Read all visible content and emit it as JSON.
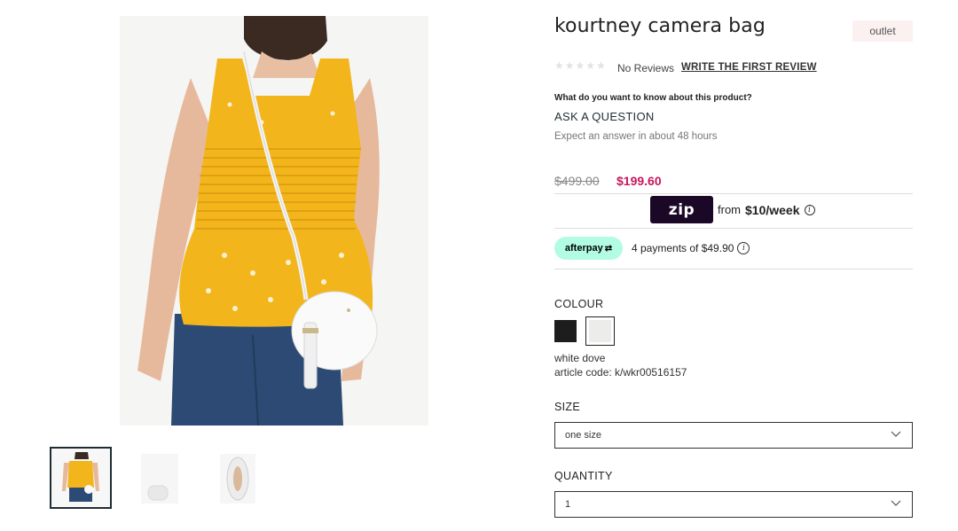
{
  "product": {
    "title": "kourtney camera bag",
    "badge": "outlet"
  },
  "reviews": {
    "rating": 0,
    "max_stars": 5,
    "count_label": "No Reviews",
    "write_link": "WRITE THE FIRST REVIEW"
  },
  "questions": {
    "prompt": "What do you want to know about this product?",
    "ask_link": "ASK A QUESTION",
    "note": "Expect an answer in about 48 hours"
  },
  "pricing": {
    "original": "$499.00",
    "sale": "$199.60",
    "sale_color": "#c5185d"
  },
  "zip": {
    "logo_text": "zip",
    "from_label": "from",
    "amount": "$10/week",
    "info_icon": "info-icon"
  },
  "afterpay": {
    "logo_text": "afterpay",
    "payments": "4 payments of $49.90",
    "info_icon": "info-icon",
    "brand_color": "#b2fce4"
  },
  "colour": {
    "label": "COLOUR",
    "options": [
      {
        "name": "black",
        "hex": "#1d1d1d",
        "selected": false
      },
      {
        "name": "white dove",
        "hex": "#ececea",
        "selected": true
      }
    ],
    "selected_name": "white dove",
    "article_code": "article code: k/wkr00516157"
  },
  "size": {
    "label": "SIZE",
    "selected": "one size"
  },
  "quantity": {
    "label": "QUANTITY",
    "selected": "1"
  },
  "gallery": {
    "thumbnail_count": 3,
    "selected_index": 0
  }
}
